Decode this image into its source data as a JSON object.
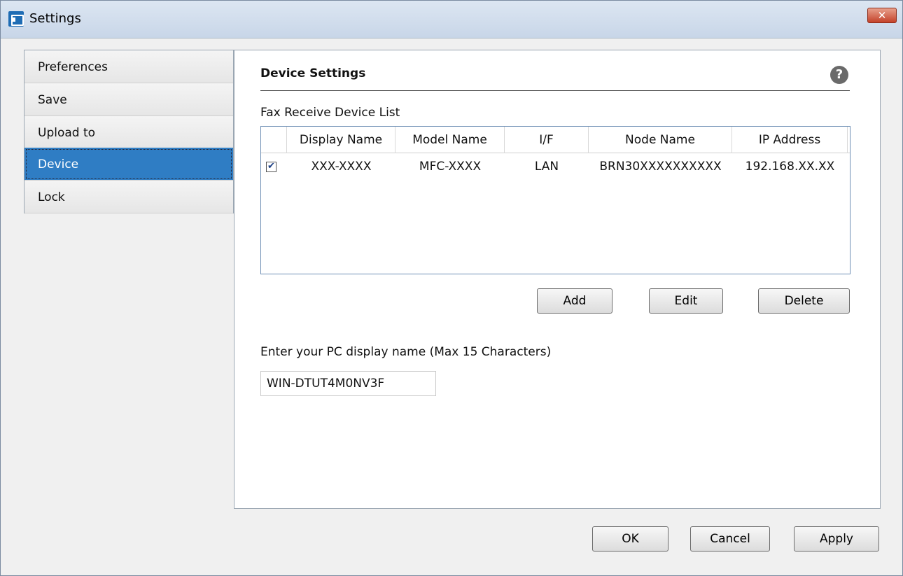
{
  "window": {
    "title": "Settings",
    "close_label": "✕"
  },
  "nav": {
    "items": [
      {
        "label": "Preferences"
      },
      {
        "label": "Save"
      },
      {
        "label": "Upload to"
      },
      {
        "label": "Device"
      },
      {
        "label": "Lock"
      }
    ],
    "selected": "Device"
  },
  "panel": {
    "section_title": "Device Settings",
    "help_icon": "?",
    "list_label": "Fax Receive Device List",
    "columns": [
      "Display Name",
      "Model Name",
      "I/F",
      "Node Name",
      "IP Address"
    ],
    "rows": [
      {
        "checked": true,
        "display_name": "XXX-XXXX",
        "model_name": "MFC-XXXX",
        "interface": "LAN",
        "node_name": "BRN30XXXXXXXXXX",
        "ip_address": "192.168.XX.XX"
      }
    ],
    "list_buttons": {
      "add": "Add",
      "edit": "Edit",
      "delete": "Delete"
    },
    "pc_name_label": "Enter your PC display name (Max 15 Characters)",
    "pc_name_value": "WIN-DTUT4M0NV3F"
  },
  "footer": {
    "ok": "OK",
    "cancel": "Cancel",
    "apply": "Apply"
  },
  "colors": {
    "selected_nav": "#2f7dc4",
    "list_border": "#6f8fb5",
    "close_button": "#c4422a"
  }
}
